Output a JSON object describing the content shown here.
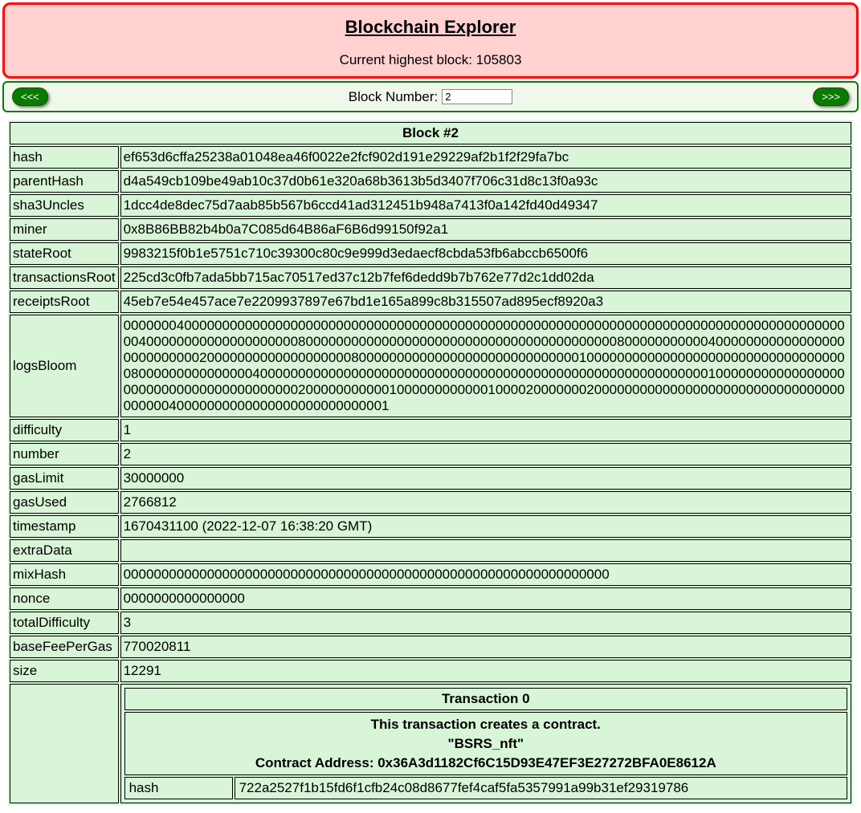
{
  "header": {
    "title": "Blockchain Explorer",
    "subtitle": "Current highest block: 105803"
  },
  "nav": {
    "prev_label": "<<<",
    "next_label": ">>>",
    "block_number_label": "Block Number:",
    "block_number_value": "2"
  },
  "block": {
    "table_title": "Block #2",
    "fields": [
      {
        "key": "hash",
        "value": "ef653d6cffa25238a01048ea46f0022e2fcf902d191e29229af2b1f2f29fa7bc"
      },
      {
        "key": "parentHash",
        "value": "d4a549cb109be49ab10c37d0b61e320a68b3613b5d3407f706c31d8c13f0a93c"
      },
      {
        "key": "sha3Uncles",
        "value": "1dcc4de8dec75d7aab85b567b6ccd41ad312451b948a7413f0a142fd40d49347"
      },
      {
        "key": "miner",
        "value": "0x8B86BB82b4b0a7C085d64B86aF6B6d99150f92a1"
      },
      {
        "key": "stateRoot",
        "value": "9983215f0b1e5751c710c39300c80c9e999d3edaecf8cbda53fb6abccb6500f6"
      },
      {
        "key": "transactionsRoot",
        "value": "225cd3c0fb7ada5bb715ac70517ed37c12b7fef6dedd9b7b762e77d2c1dd02da"
      },
      {
        "key": "receiptsRoot",
        "value": "45eb7e54e457ace7e2209937897e67bd1e165a899c8b315507ad895ecf8920a3"
      },
      {
        "key": "logsBloom",
        "value": "000000040000000000000000000000000000000000000000000000000000000000000000000000000000000000000000040000000000000000000080000000000000000000000000000000000000000080000000000040000000000000000000000000002000000000000000000080000000000000000000000000000010000000000000000000000000000000000080000000000000004000000000000000000000000000000000000000000000000000000000001000000000000000000000000000000000000000020000000000010000000000001000020000000200000000000000000000000000000000000000040000000000000000000000000001"
      },
      {
        "key": "difficulty",
        "value": "1"
      },
      {
        "key": "number",
        "value": "2"
      },
      {
        "key": "gasLimit",
        "value": "30000000"
      },
      {
        "key": "gasUsed",
        "value": "2766812"
      },
      {
        "key": "timestamp",
        "value": "1670431100 (2022-12-07 16:38:20 GMT)"
      },
      {
        "key": "extraData",
        "value": ""
      },
      {
        "key": "mixHash",
        "value": "0000000000000000000000000000000000000000000000000000000000000000"
      },
      {
        "key": "nonce",
        "value": "0000000000000000"
      },
      {
        "key": "totalDifficulty",
        "value": "3"
      },
      {
        "key": "baseFeePerGas",
        "value": "770020811"
      },
      {
        "key": "size",
        "value": "12291"
      }
    ],
    "transaction": {
      "title": "Transaction 0",
      "contract_line1": "This transaction creates a contract.",
      "contract_line2": "\"BSRS_nft\"",
      "contract_line3": "Contract Address: 0x36A3d1182Cf6C15D93E47EF3E27272BFA0E8612A",
      "fields": [
        {
          "key": "hash",
          "value": "722a2527f1b15fd6f1cfb24c08d8677fef4caf5fa5357991a99b31ef29319786"
        }
      ]
    }
  }
}
